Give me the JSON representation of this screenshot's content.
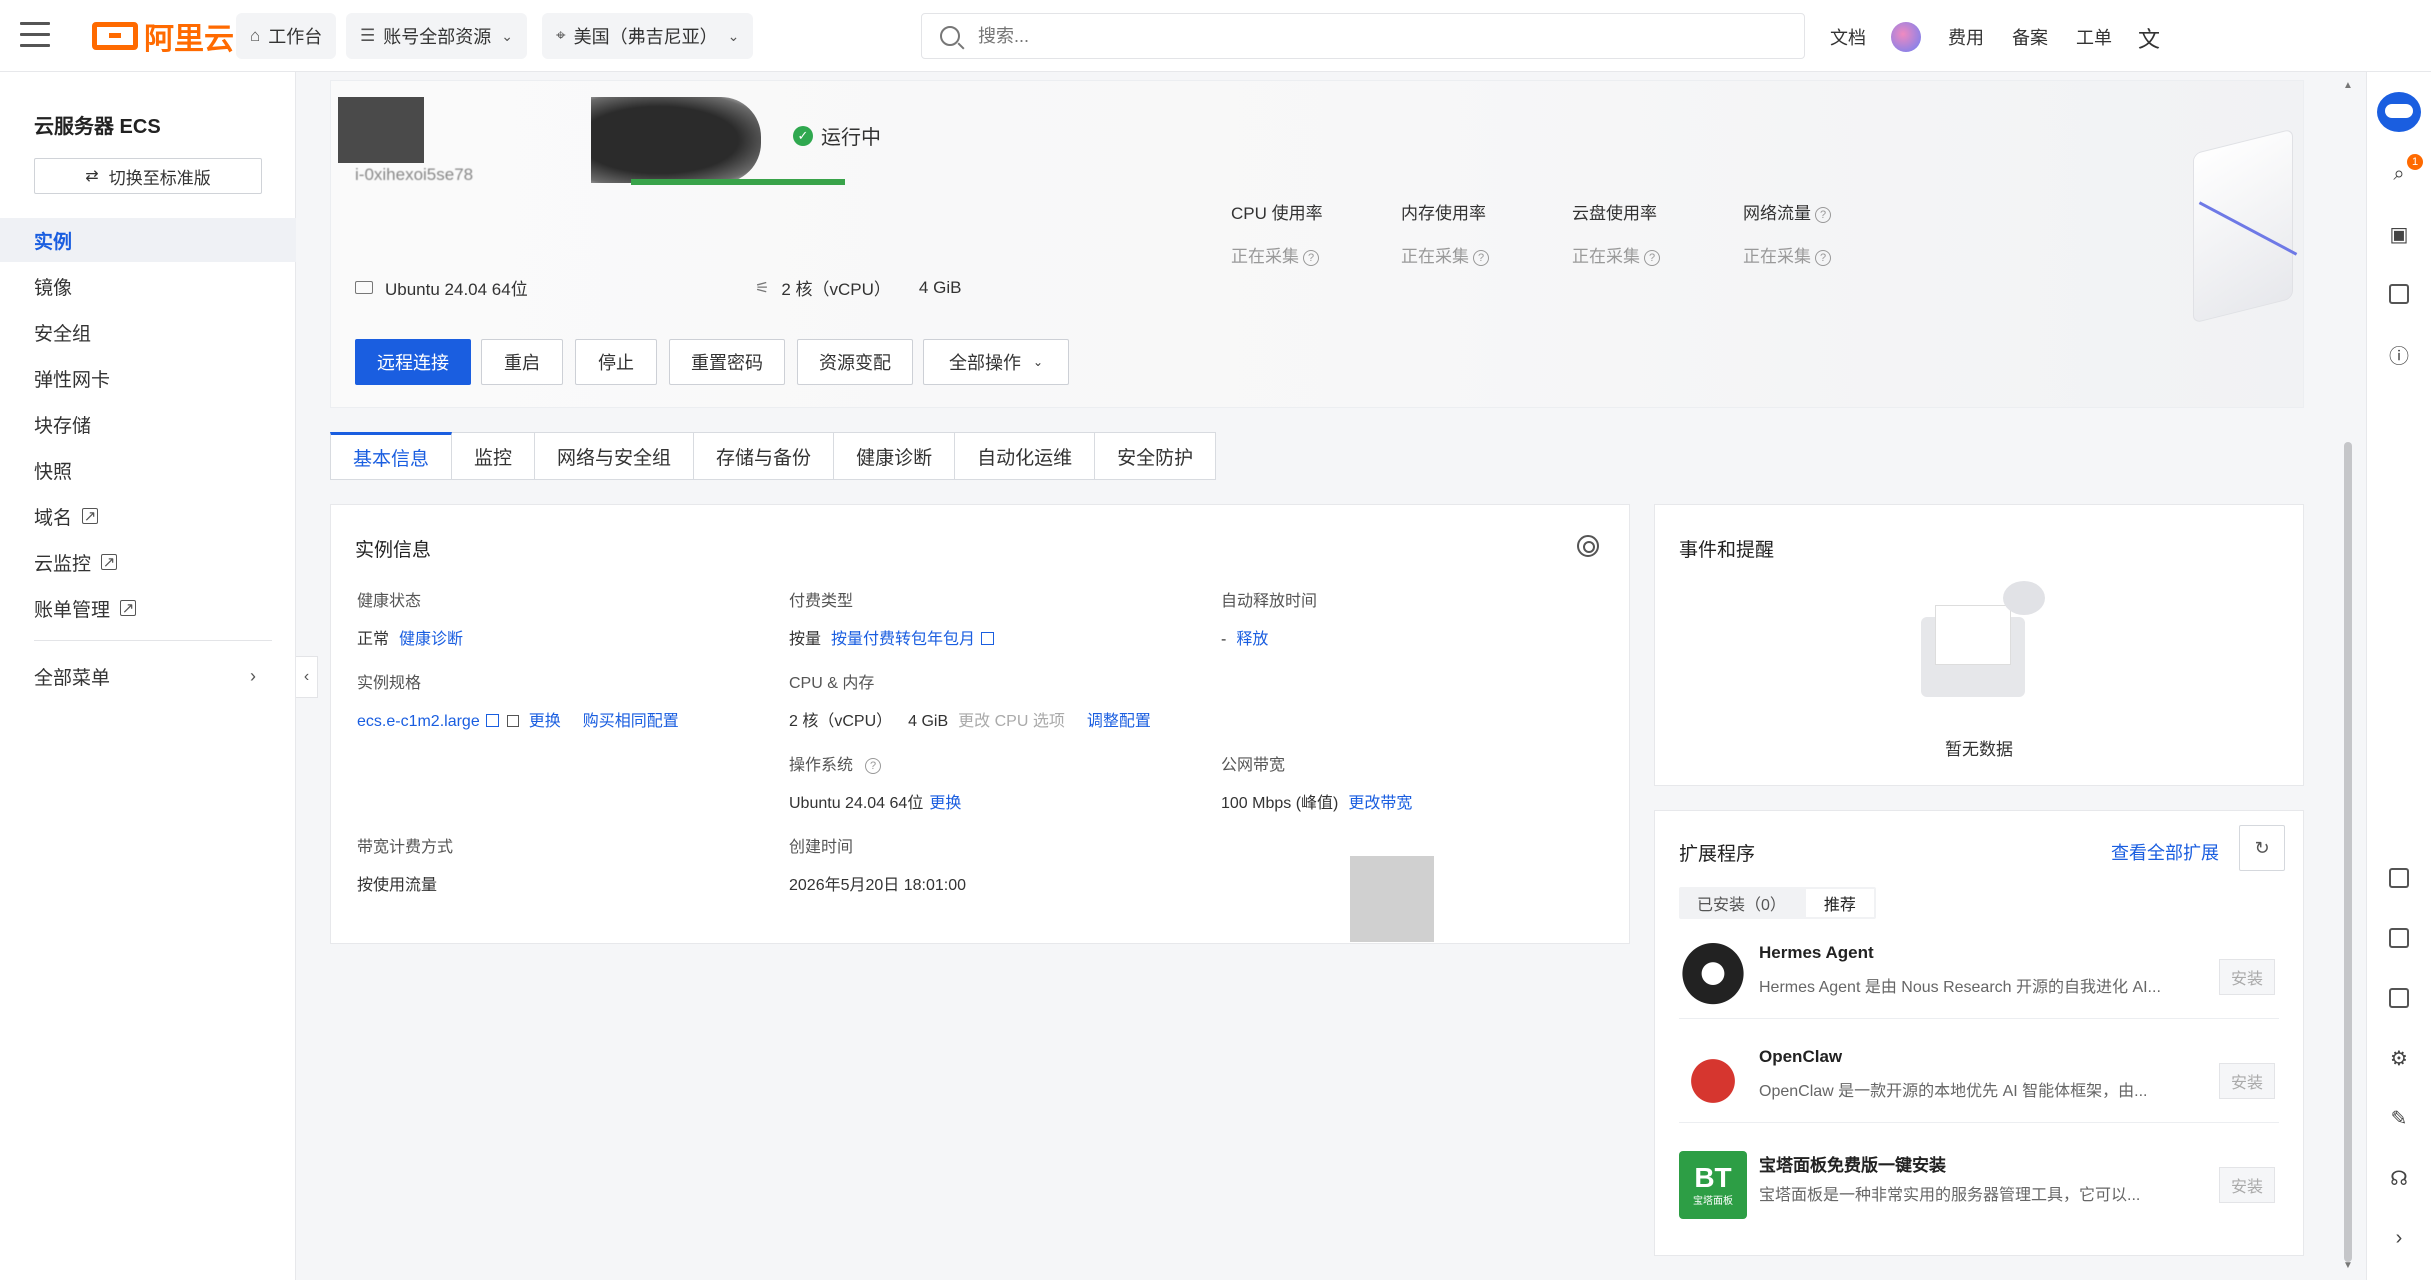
{
  "topbar": {
    "brand": "阿里云",
    "workbench": "工作台",
    "account_scope": "账号全部资源",
    "region": "美国（弗吉尼亚）",
    "search_placeholder": "搜索...",
    "links": [
      "文档",
      "费用",
      "备案",
      "工单"
    ]
  },
  "sidebar": {
    "title": "云服务器 ECS",
    "switch_label": "切换至标准版",
    "items": [
      {
        "label": "实例",
        "active": true
      },
      {
        "label": "镜像"
      },
      {
        "label": "安全组"
      },
      {
        "label": "弹性网卡"
      },
      {
        "label": "块存储"
      },
      {
        "label": "快照"
      },
      {
        "label": "域名",
        "external": true
      },
      {
        "label": "云监控",
        "external": true
      },
      {
        "label": "账单管理",
        "external": true
      }
    ],
    "all_menu": "全部菜单"
  },
  "hero": {
    "instance_id": "i-0xihexoi5se78",
    "status": "运行中",
    "os": "Ubuntu 24.04 64位",
    "cpu": "2 核（vCPU）",
    "memory": "4 GiB",
    "buttons": [
      "远程连接",
      "重启",
      "停止",
      "重置密码",
      "资源变配",
      "全部操作"
    ],
    "metrics": [
      {
        "label": "CPU 使用率",
        "value": "正在采集"
      },
      {
        "label": "内存使用率",
        "value": "正在采集"
      },
      {
        "label": "云盘使用率",
        "value": "正在采集"
      },
      {
        "label": "网络流量",
        "value": "正在采集"
      }
    ]
  },
  "tabs": [
    "基本信息",
    "监控",
    "网络与安全组",
    "存储与备份",
    "健康诊断",
    "自动化运维",
    "安全防护"
  ],
  "instance_info": {
    "title": "实例信息",
    "health_label": "健康状态",
    "health_value": "正常",
    "health_link": "健康诊断",
    "billing_label": "付费类型",
    "billing_value": "按量",
    "billing_link": "按量付费转包年包月",
    "release_label": "自动释放时间",
    "release_value": "-",
    "release_link": "释放",
    "spec_label": "实例规格",
    "spec_value": "ecs.e-c1m2.large",
    "spec_change": "更换",
    "spec_buy": "购买相同配置",
    "cpu_mem_label": "CPU & 内存",
    "cpu_value": "2 核（vCPU）",
    "mem_value": "4 GiB",
    "cpu_option": "更改 CPU 选项",
    "cpu_adjust": "调整配置",
    "os_label": "操作系统",
    "os_value": "Ubuntu 24.04 64位",
    "os_change": "更换",
    "bandwidth_label": "公网带宽",
    "bandwidth_value": "100 Mbps (峰值)",
    "bandwidth_link": "更改带宽",
    "bw_billing_label": "带宽计费方式",
    "bw_billing_value": "按使用流量",
    "created_label": "创建时间",
    "created_value": "2026年5月20日 18:01:00"
  },
  "events": {
    "title": "事件和提醒",
    "empty": "暂无数据"
  },
  "extensions": {
    "title": "扩展程序",
    "view_all": "查看全部扩展",
    "tab_installed": "已安装（0）",
    "tab_recommended": "推荐",
    "install_label": "安装",
    "items": [
      {
        "name": "Hermes Agent",
        "desc": "Hermes Agent 是由 Nous Research 开源的自我进化 AI..."
      },
      {
        "name": "OpenClaw",
        "desc": "OpenClaw 是一款开源的本地优先 AI 智能体框架，由..."
      },
      {
        "name": "宝塔面板免费版一键安装",
        "desc": "宝塔面板是一种非常实用的服务器管理工具，它可以..."
      }
    ],
    "bt_logo": "BT",
    "bt_logo_sub": "宝塔面板"
  },
  "rail": {
    "badge": "1"
  }
}
